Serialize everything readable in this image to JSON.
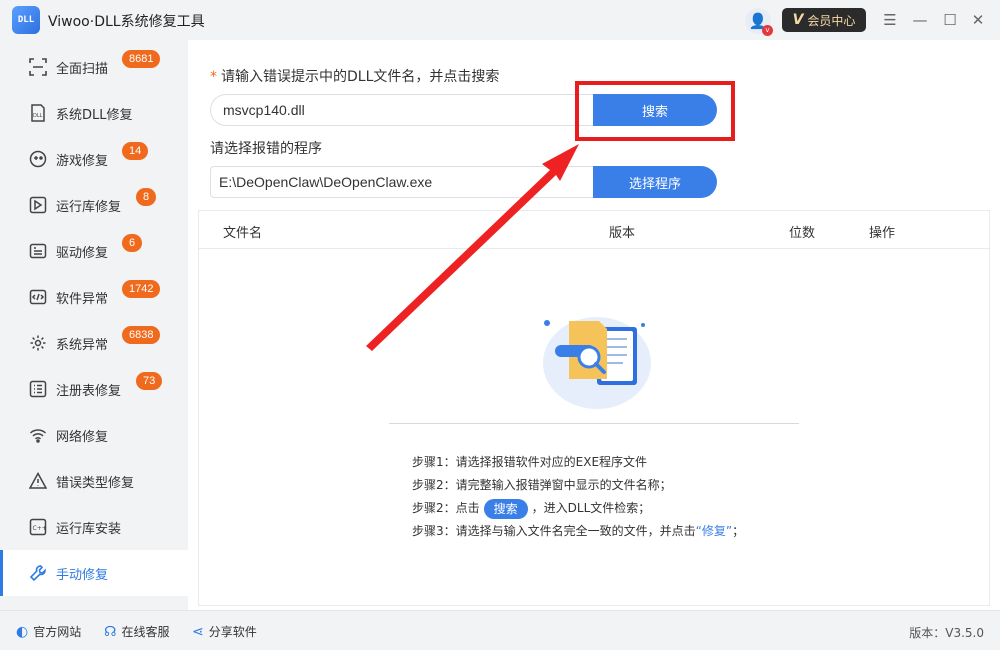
{
  "app": {
    "logo_text": "DLL",
    "title": "Viwoo·DLL系统修复工具"
  },
  "header": {
    "vip_icon": "V",
    "vip_label": "会员中心",
    "avatar_icon": "user-avatar-icon",
    "avatar_badge": "v"
  },
  "window_controls": {
    "menu": "☰",
    "minimize": "—",
    "maximize": "☐",
    "close": "✕"
  },
  "sidebar": {
    "items": [
      {
        "label": "全面扫描",
        "badge": "8681",
        "icon": "scan-icon"
      },
      {
        "label": "系统DLL修复",
        "badge": "",
        "icon": "dll-icon"
      },
      {
        "label": "游戏修复",
        "badge": "14",
        "icon": "gamepad-icon"
      },
      {
        "label": "运行库修复",
        "badge": "8",
        "icon": "runtime-icon"
      },
      {
        "label": "驱动修复",
        "badge": "6",
        "icon": "driver-icon"
      },
      {
        "label": "软件异常",
        "badge": "1742",
        "icon": "code-icon"
      },
      {
        "label": "系统异常",
        "badge": "6838",
        "icon": "gear-icon"
      },
      {
        "label": "注册表修复",
        "badge": "73",
        "icon": "list-icon"
      },
      {
        "label": "网络修复",
        "badge": "",
        "icon": "wifi-icon"
      },
      {
        "label": "错误类型修复",
        "badge": "",
        "icon": "warning-icon"
      },
      {
        "label": "运行库安装",
        "badge": "",
        "icon": "install-icon"
      },
      {
        "label": "手动修复",
        "badge": "",
        "icon": "wrench-icon"
      }
    ],
    "active_index": 11
  },
  "main": {
    "required_star": "*",
    "dll_label": "请输入错误提示中的DLL文件名，并点击搜索",
    "dll_value": "msvcp140.dll",
    "search_button": "搜索",
    "program_label": "请选择报错的程序",
    "program_value": "E:\\DeOpenClaw\\DeOpenClaw.exe",
    "select_button": "选择程序",
    "table_headers": {
      "filename": "文件名",
      "version": "版本",
      "bits": "位数",
      "action": "操作"
    },
    "steps": [
      {
        "prefix": "步骤1：",
        "text": "请选择报错软件对应的EXE程序文件"
      },
      {
        "prefix": "步骤2：",
        "text": "请完整输入报错弹窗中显示的文件名称；"
      },
      {
        "prefix": "步骤2：",
        "before": "点击",
        "pill": "搜索",
        "after": "，进入DLL文件检索；"
      },
      {
        "prefix": "步骤3：",
        "before": "请选择与输入文件名完全一致的文件，并点击",
        "link": "“修复”",
        "after": "；"
      }
    ]
  },
  "footer": {
    "website": "官方网站",
    "support": "在线客服",
    "share": "分享软件",
    "version": "版本：V3.5.0"
  },
  "colors": {
    "accent": "#3a7fe8",
    "badge": "#f06a1d",
    "highlight": "#e81e1e"
  }
}
